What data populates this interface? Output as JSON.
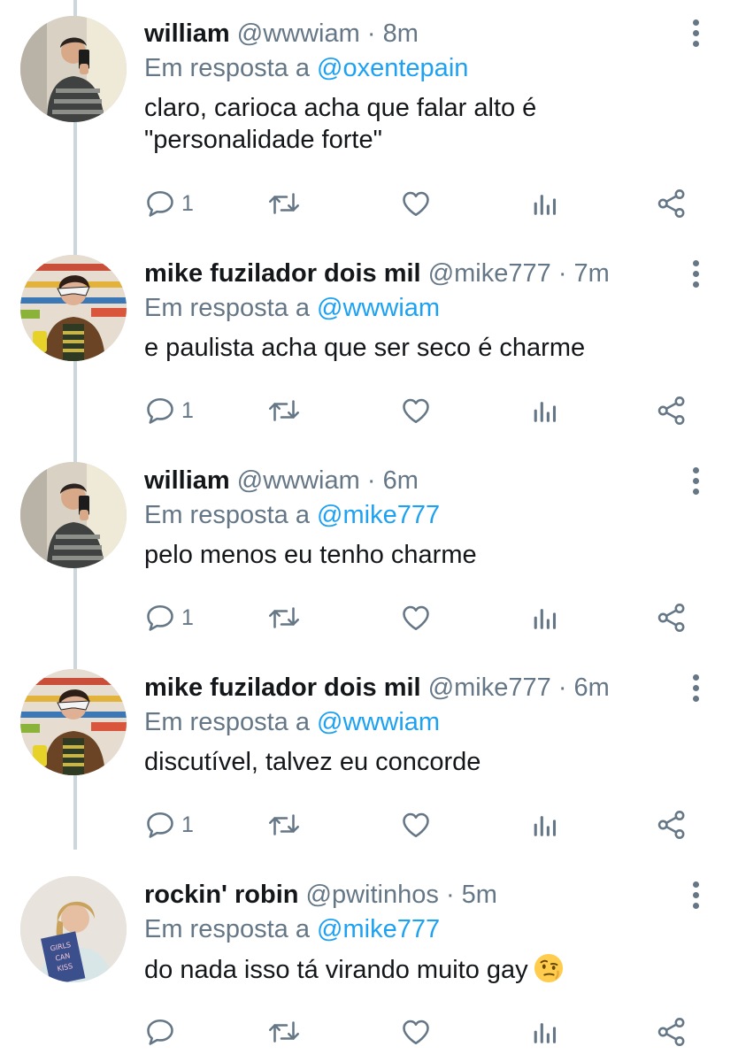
{
  "reply_prefix": "Em resposta a",
  "tweets": [
    {
      "name": "william",
      "handle": "@wwwiam",
      "time": "8m",
      "reply_to": "@oxentepain",
      "text_lines": [
        "claro, carioca acha que falar alto é",
        "\"personalidade forte\""
      ],
      "replies": "1",
      "avatar": "william"
    },
    {
      "name": "mike fuzilador dois mil",
      "handle": "@mike777",
      "time": "7m",
      "reply_to": "@wwwiam",
      "text_lines": [
        "e paulista acha que ser seco é charme"
      ],
      "replies": "1",
      "avatar": "mike"
    },
    {
      "name": "william",
      "handle": "@wwwiam",
      "time": "6m",
      "reply_to": "@mike777",
      "text_lines": [
        "pelo menos eu tenho charme"
      ],
      "replies": "1",
      "avatar": "william"
    },
    {
      "name": "mike fuzilador dois mil",
      "handle": "@mike777",
      "time": "6m",
      "reply_to": "@wwwiam",
      "text_lines": [
        "discutível, talvez eu concorde"
      ],
      "replies": "1",
      "avatar": "mike"
    },
    {
      "name": "rockin' robin",
      "handle": "@pwitinhos",
      "time": "5m",
      "reply_to": "@mike777",
      "text_lines": [
        "do nada isso tá virando muito gay"
      ],
      "replies": "",
      "avatar": "robin",
      "emoji": "face-with-raised-eyebrow"
    }
  ],
  "colors": {
    "text": "#14171a",
    "secondary": "#657786",
    "mention": "#1da1f2",
    "thread_line": "#ccd6dd"
  },
  "icons": [
    "reply-icon",
    "retweet-icon",
    "like-icon",
    "analytics-icon",
    "share-icon",
    "more-icon"
  ]
}
